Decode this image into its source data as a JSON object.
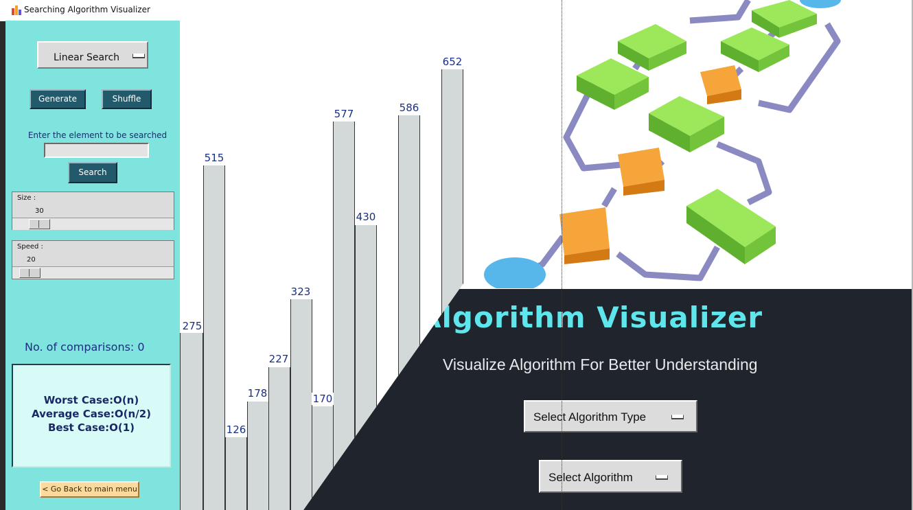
{
  "window": {
    "title": "Searching Algorithm Visualizer"
  },
  "sidebar": {
    "algorithm_dropdown": "Linear Search",
    "generate_label": "Generate",
    "shuffle_label": "Shuffle",
    "search_prompt": "Enter the element to be searched",
    "search_input": {
      "value": "",
      "placeholder": ""
    },
    "search_label": "Search",
    "size": {
      "label": "Size :",
      "value": "30",
      "fraction": 0.1
    },
    "speed": {
      "label": "Speed :",
      "value": "20",
      "fraction": 0.05
    },
    "comparisons": "No. of comparisons: 0",
    "complexity": {
      "worst": "Worst Case:O(n)",
      "average": "Average Case:O(n/2)",
      "best": "Best Case:O(1)"
    },
    "back_label": "< Go Back to main menu"
  },
  "bars": [
    "275",
    "515",
    "126",
    "178",
    "227",
    "323",
    "170",
    "577",
    "430",
    "586",
    "652"
  ],
  "menu": {
    "title": "Algorithm Visualizer",
    "subtitle": "Visualize Algorithm For Better Understanding",
    "type_dropdown": "Select Algorithm Type",
    "algo_dropdown": "Select Algorithm"
  },
  "colors": {
    "sidebar_bg": "#7fe3de",
    "button_dark": "#235a6b",
    "dark_panel": "#20242c",
    "title_cyan": "#5ee6ec",
    "box_green": "#8ee04a",
    "box_orange": "#f39a2a",
    "arrow_purple": "#8a89c2"
  },
  "icons": [
    "app-icon",
    "dropdown-caret-icon"
  ]
}
